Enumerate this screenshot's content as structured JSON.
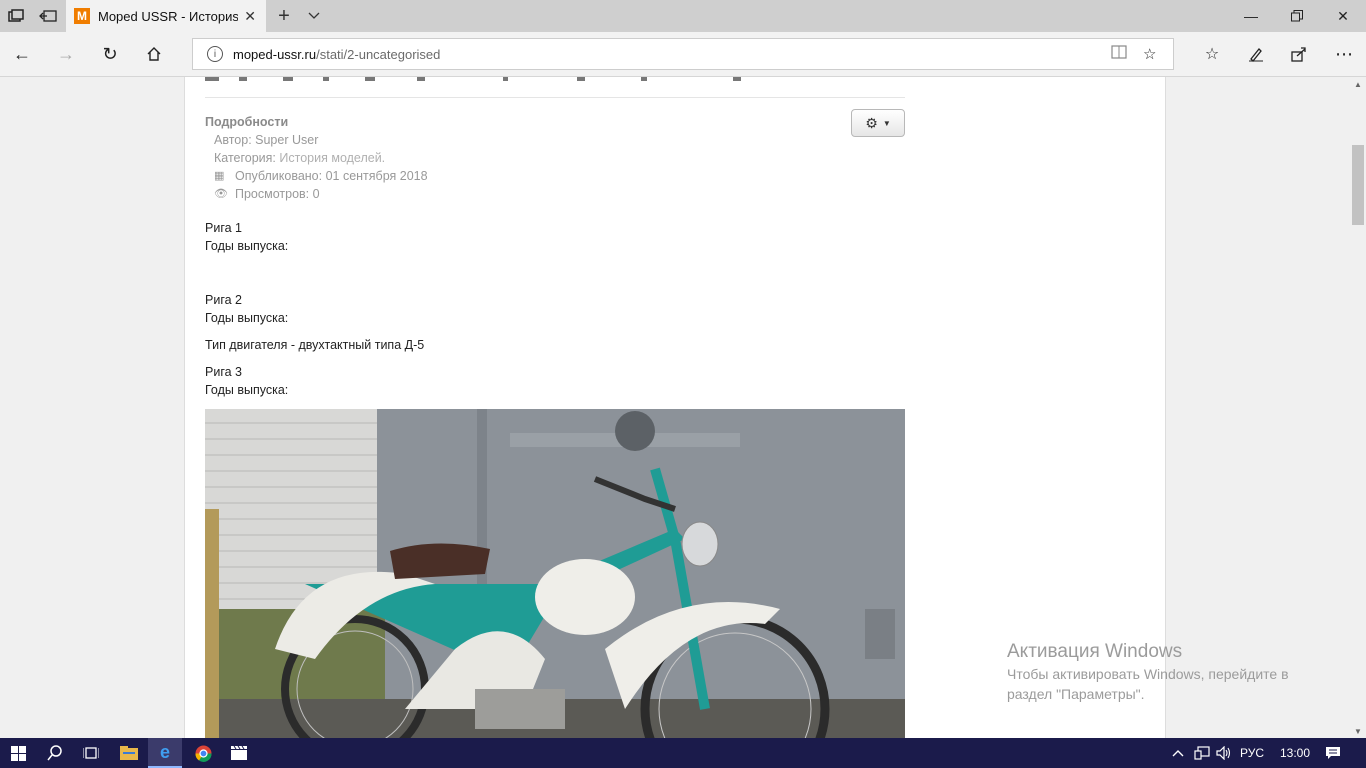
{
  "browser": {
    "tab_title": "Moped USSR - Историs",
    "tab_favicon_letter": "M",
    "url_host": "moped-ussr.ru",
    "url_path": "/stati/2-uncategorised"
  },
  "article": {
    "details_label": "Подробности",
    "author": "Автор: Super User",
    "category_prefix": "Категория:",
    "category_link": "История моделей.",
    "published": "Опубликовано: 01 сентября 2018",
    "views": "Просмотров: 0",
    "paragraphs": [
      {
        "title": "Рига 1",
        "line": "Годы выпуска:"
      },
      {
        "title": "Рига 2",
        "line": "Годы выпуска:"
      },
      {
        "engine": "Тип двигателя - двухтактный типа Д-5"
      },
      {
        "title": "Рига 3",
        "line": "Годы выпуска:"
      }
    ]
  },
  "watermark": {
    "title": "Активация Windows",
    "line1": "Чтобы активировать Windows, перейдите в",
    "line2": "раздел \"Параметры\"."
  },
  "taskbar": {
    "lang": "РУС",
    "time": "13:00"
  },
  "colors": {
    "accent_edge": "#0078d7",
    "favicon": "#f07d00",
    "taskbar": "#1b1b4b"
  }
}
